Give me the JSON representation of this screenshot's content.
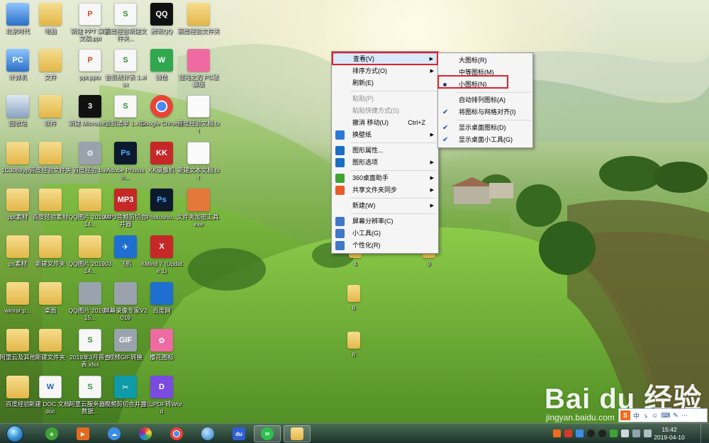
{
  "desktop_icons": [
    {
      "id": "i1",
      "label": "北京时代",
      "glyph": "",
      "style": "g-pc"
    },
    {
      "id": "i2",
      "label": "电脑",
      "glyph": "",
      "style": "g-folder"
    },
    {
      "id": "i3",
      "label": "新建 PPT 演示文稿.ppt",
      "glyph": "P",
      "style": "g-ppt"
    },
    {
      "id": "i4",
      "label": "百度经验新建文件夹...",
      "glyph": "S",
      "style": "g-doc"
    },
    {
      "id": "i5",
      "label": "腾讯QQ",
      "glyph": "QQ",
      "style": "g-black"
    },
    {
      "id": "i6",
      "label": "百度经验文件夹",
      "glyph": "",
      "style": "g-folder"
    },
    {
      "id": "i7",
      "label": "计算机",
      "glyph": "PC",
      "style": "g-pc"
    },
    {
      "id": "i8",
      "label": "文件",
      "glyph": "",
      "style": "g-folder"
    },
    {
      "id": "i9",
      "label": "ppt.pptx",
      "glyph": "P",
      "style": "g-ppt"
    },
    {
      "id": "i10",
      "label": "会员统计表 1.xlsx",
      "glyph": "S",
      "style": "g-doc"
    },
    {
      "id": "i11",
      "label": "微信",
      "glyph": "W",
      "style": "g-green"
    },
    {
      "id": "i12",
      "label": "混沌之刃 PC破解版",
      "glyph": "",
      "style": "g-pink"
    },
    {
      "id": "i13",
      "label": "回收站",
      "glyph": "",
      "style": "g-trash"
    },
    {
      "id": "i14",
      "label": "软件",
      "glyph": "",
      "style": "g-folder"
    },
    {
      "id": "i15",
      "label": "新建 Microsoft...",
      "glyph": "3",
      "style": "g-black"
    },
    {
      "id": "i16",
      "label": "会员清单 1.xlsx",
      "glyph": "S",
      "style": "g-doc"
    },
    {
      "id": "i17",
      "label": "Google Chrome",
      "glyph": "",
      "style": "g-chrome"
    },
    {
      "id": "i18",
      "label": "百度经验文档.txt",
      "glyph": "",
      "style": "g-txt"
    },
    {
      "id": "i19",
      "label": "1C3068yp...",
      "glyph": "",
      "style": "g-folder"
    },
    {
      "id": "i20",
      "label": "百度经验文件夹",
      "glyph": "",
      "style": "g-folder"
    },
    {
      "id": "i21",
      "label": "百度经验.bat",
      "glyph": "⚙",
      "style": "g-gray"
    },
    {
      "id": "i22",
      "label": "Adobe Photosh...",
      "glyph": "Ps",
      "style": "g-ps"
    },
    {
      "id": "i23",
      "label": "KK录像机",
      "glyph": "KK",
      "style": "g-red"
    },
    {
      "id": "i24",
      "label": "新建文本文档.txt",
      "glyph": "",
      "style": "g-txt"
    },
    {
      "id": "i25",
      "label": "ppt素材",
      "glyph": "",
      "style": "g-folder"
    },
    {
      "id": "i26",
      "label": "百度经验素材",
      "glyph": "",
      "style": "g-folder"
    },
    {
      "id": "i27",
      "label": "QQ图片 20190314...",
      "glyph": "",
      "style": "g-folder"
    },
    {
      "id": "i28",
      "label": "MP3音频剪切合并器",
      "glyph": "MP3",
      "style": "g-red"
    },
    {
      "id": "i29",
      "label": "Photosho...",
      "glyph": "Ps",
      "style": "g-ps"
    },
    {
      "id": "i30",
      "label": "文件夹加密工具.exe",
      "glyph": "",
      "style": "g-orange"
    },
    {
      "id": "i31",
      "label": "ps素材",
      "glyph": "",
      "style": "g-folder"
    },
    {
      "id": "i32",
      "label": "新建文件夹",
      "glyph": "",
      "style": "g-folder"
    },
    {
      "id": "i33",
      "label": "QQ图片 20190314...",
      "glyph": "",
      "style": "g-folder"
    },
    {
      "id": "i34",
      "label": "飞机",
      "glyph": "✈",
      "style": "g-blue"
    },
    {
      "id": "i35",
      "label": "XMind 7 (Update 1)",
      "glyph": "X",
      "style": "g-red"
    },
    {
      "id": "i36",
      "label": "winrar p...",
      "glyph": "",
      "style": "g-folder"
    },
    {
      "id": "i37",
      "label": "桌面",
      "glyph": "",
      "style": "g-folder"
    },
    {
      "id": "i38",
      "label": "QQ图片 20190315...",
      "glyph": "",
      "style": "g-gray"
    },
    {
      "id": "i39",
      "label": "屏幕录像专家V2019",
      "glyph": "",
      "style": "g-gray"
    },
    {
      "id": "i40",
      "label": "百度网",
      "glyph": "",
      "style": "g-blue"
    },
    {
      "id": "i41",
      "label": "阿里云及其他",
      "glyph": "",
      "style": "g-folder"
    },
    {
      "id": "i42",
      "label": "新建文件夹",
      "glyph": "",
      "style": "g-folder"
    },
    {
      "id": "i43",
      "label": "2019年3月普查表.xlsx",
      "glyph": "S",
      "style": "g-doc"
    },
    {
      "id": "i44",
      "label": "视频GIF转换",
      "glyph": "GIF",
      "style": "g-gray"
    },
    {
      "id": "i45",
      "label": "樱花图标",
      "glyph": "✿",
      "style": "g-pink"
    },
    {
      "id": "i46",
      "label": "百度经验",
      "glyph": "",
      "style": "g-folder"
    },
    {
      "id": "i47",
      "label": "新建 DOC 文档.doc",
      "glyph": "W",
      "style": "g-word"
    },
    {
      "id": "i48",
      "label": "阿里云服务器及数据...",
      "glyph": "S",
      "style": "g-doc"
    },
    {
      "id": "i49",
      "label": "视频剪切合并器",
      "glyph": "✂",
      "style": "g-teal"
    },
    {
      "id": "i50",
      "label": "金山PDF转Word",
      "glyph": "D",
      "style": "g-purple"
    }
  ],
  "scattered_folders": [
    {
      "id": "f4",
      "label": "4"
    },
    {
      "id": "f9",
      "label": "9"
    },
    {
      "id": "f8",
      "label": "8"
    },
    {
      "id": "f6",
      "label": "6"
    }
  ],
  "context_menu": {
    "items": [
      {
        "type": "item",
        "label": "查看(V)",
        "arrow": true,
        "highlighted": true
      },
      {
        "type": "item",
        "label": "排序方式(O)",
        "arrow": true
      },
      {
        "type": "item",
        "label": "刷新(E)"
      },
      {
        "type": "sep"
      },
      {
        "type": "item",
        "label": "粘贴(P)",
        "disabled": true
      },
      {
        "type": "item",
        "label": "粘贴快捷方式(S)",
        "disabled": true
      },
      {
        "type": "item",
        "label": "撤消 移动(U)",
        "shortcut": "Ctrl+Z"
      },
      {
        "type": "item",
        "label": "换壁纸",
        "arrow": true,
        "icon": "wallpaper-icon",
        "icon_color": "#2b7ad9"
      },
      {
        "type": "sep"
      },
      {
        "type": "item",
        "label": "图形属性...",
        "icon": "intel-icon",
        "icon_color": "#1b6fc2"
      },
      {
        "type": "item",
        "label": "图形选项",
        "arrow": true,
        "icon": "intel-icon",
        "icon_color": "#1b6fc2"
      },
      {
        "type": "sep"
      },
      {
        "type": "item",
        "label": "360桌面助手",
        "arrow": true,
        "icon": "360-icon",
        "icon_color": "#3fa335"
      },
      {
        "type": "item",
        "label": "共享文件夹同步",
        "arrow": true,
        "icon": "sync-icon",
        "icon_color": "#e85c2a"
      },
      {
        "type": "sep"
      },
      {
        "type": "item",
        "label": "新建(W)",
        "arrow": true
      },
      {
        "type": "sep"
      },
      {
        "type": "item",
        "label": "屏幕分辨率(C)",
        "icon": "display-icon",
        "icon_color": "#3f78c7"
      },
      {
        "type": "item",
        "label": "小工具(G)",
        "icon": "gadget-icon",
        "icon_color": "#3f78c7"
      },
      {
        "type": "item",
        "label": "个性化(R)",
        "icon": "personalize-icon",
        "icon_color": "#3f78c7"
      }
    ]
  },
  "submenu": {
    "items": [
      {
        "type": "item",
        "label": "大图标(R)"
      },
      {
        "type": "item",
        "label": "中等图标(M)"
      },
      {
        "type": "item",
        "label": "小图标(N)",
        "bullet": true,
        "boxed": true
      },
      {
        "type": "sep"
      },
      {
        "type": "item",
        "label": "自动排列图标(A)"
      },
      {
        "type": "item",
        "label": "将图标与网格对齐(I)",
        "check": true
      },
      {
        "type": "sep"
      },
      {
        "type": "item",
        "label": "显示桌面图标(D)",
        "check": true
      },
      {
        "type": "item",
        "label": "显示桌面小工具(G)",
        "check": true
      }
    ]
  },
  "ime": {
    "lang": "中",
    "items": [
      "ゝ",
      "☺",
      "⌨",
      "✎",
      "⋯"
    ]
  },
  "watermark": {
    "text": "Bai du 经验",
    "url": "jingyan.baidu.com"
  },
  "clock": {
    "time": "15:42",
    "date": "2019-04-10"
  }
}
